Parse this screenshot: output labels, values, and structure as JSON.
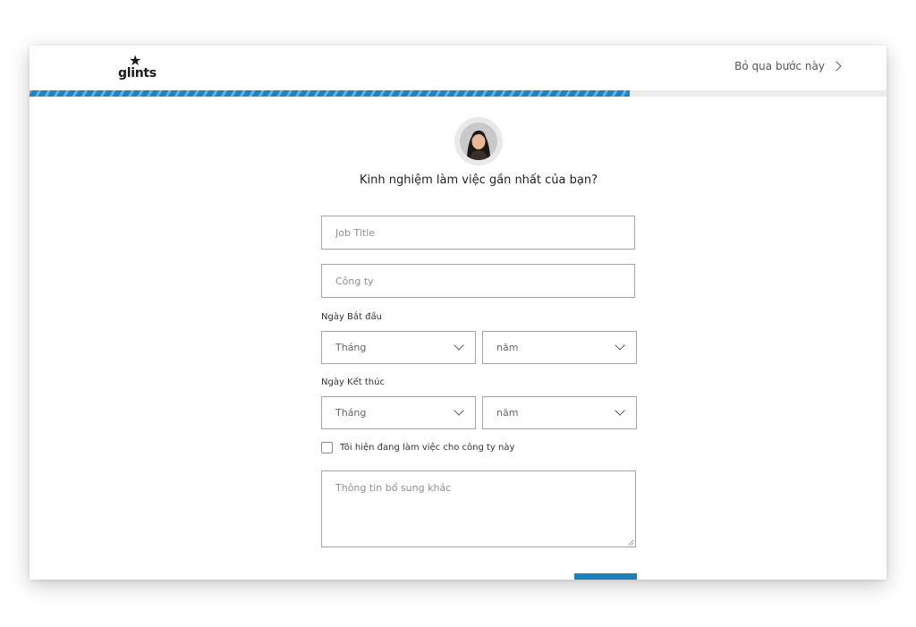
{
  "header": {
    "logo_text": "glints",
    "skip_label": "Bỏ qua bước này"
  },
  "progress": {
    "fraction": 0.7
  },
  "form": {
    "question": "Kinh nghiệm làm việc gần nhất của bạn?",
    "job_title_placeholder": "Job Title",
    "company_placeholder": "Công ty",
    "start_date_label": "Ngày Bắt đầu",
    "end_date_label": "Ngày Kết thúc",
    "month_select_value": "Tháng",
    "year_select_value": "năm",
    "current_job_label": "Tôi hiện đang làm việc cho công ty này",
    "extra_info_placeholder": "Thông tin bổ sung khác"
  },
  "colors": {
    "accent": "#1d84c2",
    "accent_stripe": "#5fb3e3",
    "button": "#1f7fb9",
    "border": "#a5a5a5"
  },
  "icons": {
    "skip": "chevron-right-icon",
    "select": "chevron-down-icon",
    "logo": "star-icon"
  }
}
